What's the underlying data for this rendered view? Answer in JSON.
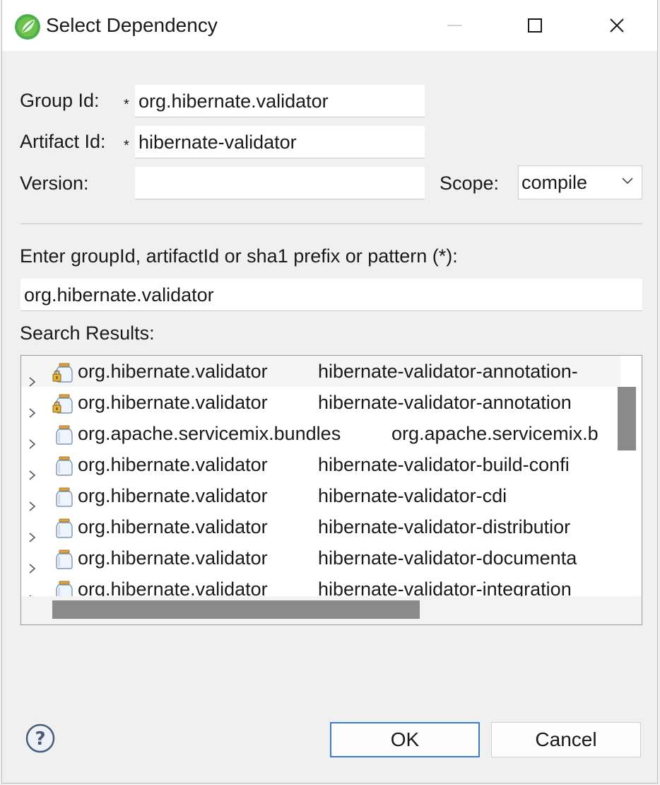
{
  "window": {
    "title": "Select Dependency"
  },
  "form": {
    "group_id_label": "Group Id:",
    "group_id_value": "org.hibernate.validator",
    "artifact_id_label": "Artifact Id:",
    "artifact_id_value": "hibernate-validator",
    "version_label": "Version:",
    "version_value": "",
    "scope_label": "Scope:",
    "scope_value": "compile",
    "required_marker": "*"
  },
  "search": {
    "prompt": "Enter groupId, artifactId or sha1 prefix or pattern (*):",
    "query": "org.hibernate.validator",
    "results_label": "Search Results:",
    "results": [
      {
        "group": "org.hibernate.validator",
        "artifact": "hibernate-validator-annotation-",
        "icon": "locked-jar-icon"
      },
      {
        "group": "org.hibernate.validator",
        "artifact": "hibernate-validator-annotation",
        "icon": "locked-jar-icon"
      },
      {
        "group": "org.apache.servicemix.bundles",
        "artifact": "org.apache.servicemix.b",
        "icon": "jar-icon"
      },
      {
        "group": "org.hibernate.validator",
        "artifact": "hibernate-validator-build-confi",
        "icon": "jar-icon"
      },
      {
        "group": "org.hibernate.validator",
        "artifact": "hibernate-validator-cdi",
        "icon": "jar-icon"
      },
      {
        "group": "org.hibernate.validator",
        "artifact": "hibernate-validator-distributior",
        "icon": "jar-icon"
      },
      {
        "group": "org.hibernate.validator",
        "artifact": "hibernate-validator-documenta",
        "icon": "jar-icon"
      },
      {
        "group": "org.hibernate.validator",
        "artifact": "hibernate-validator-integration",
        "icon": "jar-icon"
      }
    ]
  },
  "buttons": {
    "ok": "OK",
    "cancel": "Cancel"
  },
  "colors": {
    "accent": "#3b7bd6",
    "app_icon": "#4caf50"
  }
}
